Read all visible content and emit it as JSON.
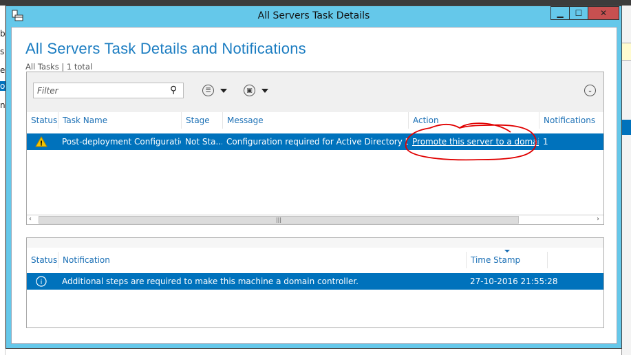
{
  "window": {
    "title": "All Servers Task Details",
    "minimize": "▁",
    "maximize": "☐",
    "close": "✕"
  },
  "background": {
    "left_fragments": [
      "b",
      "s",
      "er",
      "os",
      "n"
    ]
  },
  "heading": "All Servers Task Details and Notifications",
  "subtitle": "All Tasks | 1 total",
  "tasks": {
    "filter_placeholder": "Filter",
    "columns": [
      "Status",
      "Task Name",
      "Stage",
      "Message",
      "Action",
      "Notifications"
    ],
    "rows": [
      {
        "status_icon": "warning-icon",
        "task_name": "Post-deployment Configuration",
        "stage": "Not Sta...",
        "message": "Configuration required for Active Directory Do...",
        "action": "Promote this server to a domain...",
        "notifications": "1"
      }
    ]
  },
  "notifications": {
    "columns": [
      "Status",
      "Notification",
      "Time Stamp",
      ""
    ],
    "rows": [
      {
        "status_icon": "info-icon",
        "notification": "Additional steps are required to make this machine a domain controller.",
        "time_stamp": "27-10-2016 21:55:28"
      }
    ]
  },
  "colors": {
    "frame": "#65c8ea",
    "selection": "#0072bc",
    "heading": "#1a7cc1",
    "close": "#c75050",
    "annotation": "#e00000"
  }
}
